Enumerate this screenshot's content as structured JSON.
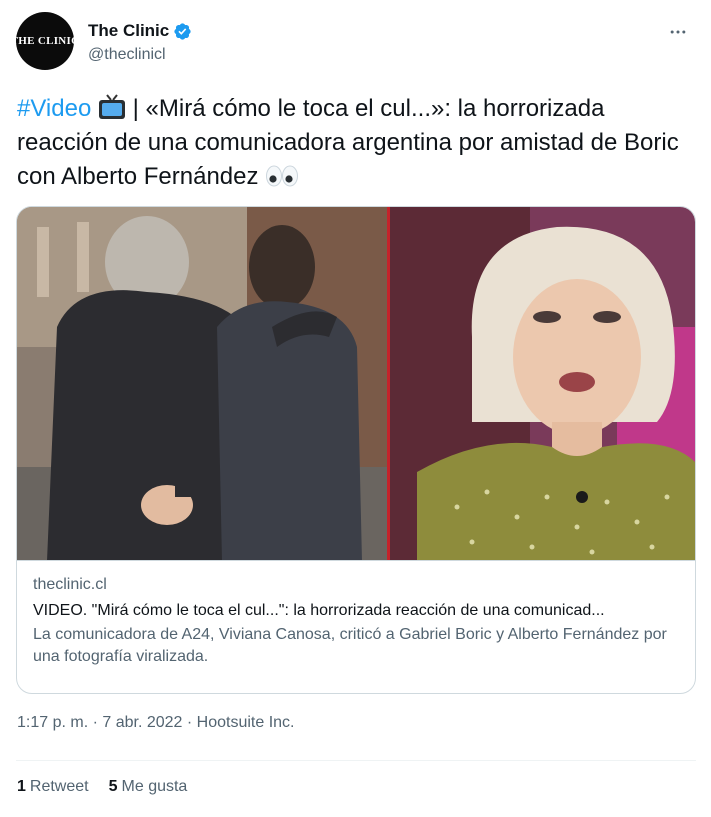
{
  "author": {
    "avatar_text": "THE CLINIC",
    "display_name": "The Clinic",
    "handle": "@theclinicl",
    "verified_icon": "verified-badge-icon"
  },
  "more_icon": "more-options-icon",
  "tweet": {
    "hashtag": "#Video",
    "text_after_tv": " | «Mirá cómo le toca el cul...»: la horrorizada reacción de una comunicadora argentina por amistad de Boric con Alberto Fernández ",
    "emojis": [
      "tv-emoji",
      "eyes-emoji"
    ]
  },
  "card": {
    "domain": "theclinic.cl",
    "title": "VIDEO. \"Mirá cómo le toca el cul...\": la horrorizada reacción de una comunicad...",
    "description": "La comunicadora de A24, Viviana Canosa, criticó a Gabriel Boric y Alberto Fernández por una fotografía viralizada."
  },
  "meta": {
    "time": "1:17 p. m.",
    "sep1": " · ",
    "date": "7 abr. 2022",
    "sep2": " · ",
    "source": "Hootsuite Inc."
  },
  "stats": {
    "retweets_count": "1",
    "retweets_label": "Retweet",
    "likes_count": "5",
    "likes_label": "Me gusta"
  },
  "colors": {
    "link": "#1d9bf0",
    "secondary": "#536471",
    "primary_text": "#0f1419",
    "border": "#cfd9de"
  }
}
